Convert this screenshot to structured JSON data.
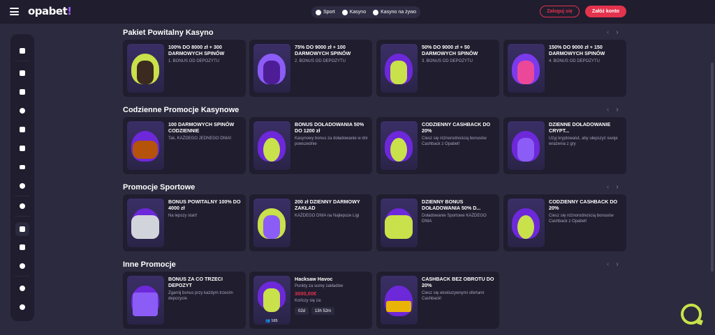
{
  "topbar": {
    "logo_main": "opabet",
    "logo_accent": "!",
    "nav": [
      {
        "label": "Sport",
        "icon": "soccer-ball-icon"
      },
      {
        "label": "Kasyno",
        "icon": "casino-chip-icon"
      },
      {
        "label": "Kasyno na żywo",
        "icon": "live-casino-icon"
      }
    ],
    "login_label": "Zaloguj się",
    "register_label": "Załóż konto"
  },
  "sidebar": {
    "icons": [
      "lobby-icon",
      "slots-icon",
      "grid-icon",
      "roulette-icon",
      "cards-icon",
      "dice-icon",
      "tv-icon",
      "jackpot-icon",
      "soccer-icon",
      "megaphone-icon",
      "trophy-icon",
      "user-icon",
      "support-icon",
      "language-icon"
    ]
  },
  "sections": [
    {
      "title": "Pakiet Powitalny Kasyno",
      "cards": [
        {
          "title": "100% DO 8000 zł + 300 DARMOWYCH SPINÓW",
          "desc": "1. BONUS OD DEPOZYTU",
          "accent": "#c9e14a"
        },
        {
          "title": "75% DO 9000 zł + 100 DARMOWYCH SPINÓW",
          "desc": "2. BONUS OD DEPOZYTU",
          "accent": "#8b5cf6"
        },
        {
          "title": "50% DO 9000 zł + 50 DARMOWYCH SPINÓW",
          "desc": "3. BONUS OD DEPOZYTU",
          "accent": "#f2a0c7"
        },
        {
          "title": "150% DO 9000 zł + 150 DARMOWYCH SPINÓW",
          "desc": "4. BONUS OD DEPOZYTU",
          "accent": "#ec4899"
        }
      ]
    },
    {
      "title": "Codzienne Promocje Kasynowe",
      "cards": [
        {
          "title": "100 DARMOWYCH SPINÓW CODZIENNIE",
          "desc": "Tak, KAŻDEGO JEDNEGO DNIA!",
          "accent": "#b45309"
        },
        {
          "title": "BONUS DOŁADOWANIA 50% DO 1200 zł",
          "desc": "Kasynowy bonus za doładowanie w dni powszednie",
          "accent": "#c9e14a"
        },
        {
          "title": "CODZIENNY CASHBACK DO 20%",
          "desc": "Ciesz się różnorodnością bonusów Cashback z Opabet!",
          "accent": "#c9e14a"
        },
        {
          "title": "DZIENNE DOŁADOWANIE CRYPT...",
          "desc": "Użyj kryptowalut, aby ulepszyć swoje wrażenia z gry",
          "accent": "#8b5cf6"
        }
      ]
    },
    {
      "title": "Promocje Sportowe",
      "cards": [
        {
          "title": "BONUS POWITALNY 100% DO 4000 zł",
          "desc": "Na lepszy start!",
          "accent": "#d1d5db"
        },
        {
          "title": "200 zł DZIENNY DARMOWY ZAKŁAD",
          "desc": "KAŻDEGO DNIA na Najlepsze Ligi",
          "accent": "#8b5cf6"
        },
        {
          "title": "DZIENNY BONUS DOŁADOWANIA 50% D...",
          "desc": "Doładowanie Sportowe KAŻDEGO DNIA",
          "accent": "#c9e14a"
        },
        {
          "title": "CODZIENNY CASHBACK DO 20%",
          "desc": "Ciesz się różnorodnością bonusów Cashback z Opabet!",
          "accent": "#c9e14a"
        }
      ]
    },
    {
      "title": "Inne Promocje",
      "cards": [
        {
          "title": "BONUS ZA CO TRZECI DEPOZYT",
          "desc": "Zgarnij bonus przy każdym trzecim depozycie",
          "accent": "#8b5cf6"
        },
        {
          "title": "Hacksaw Havoc",
          "desc": "Punkty za sumę zakładów",
          "accent": "#c9e14a"
        },
        {
          "title": "CASHBACK BEZ OBROTU DO 20%",
          "desc": "Ciesz się ekskluzywnymi ofertami Cashback!",
          "accent": "#eab308"
        }
      ]
    }
  ],
  "tournament": {
    "price": "3000,00€",
    "ends_label": "Kończy się za:",
    "days": "02d",
    "time": "13h 52m",
    "players": "165"
  },
  "colors": {
    "brand_red": "#e3334d",
    "lime": "#c9e14a",
    "purple": "#8b5cf6"
  }
}
